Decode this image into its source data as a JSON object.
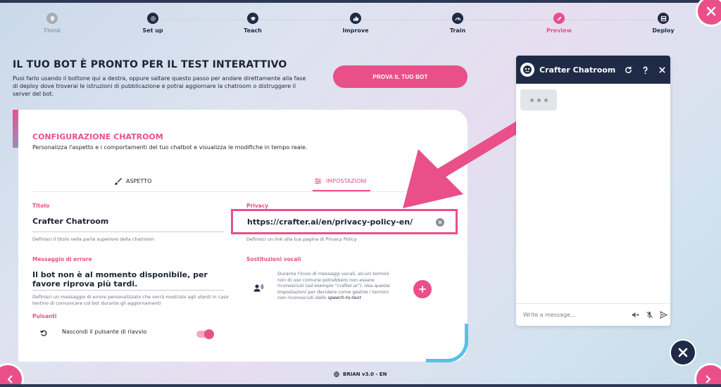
{
  "stepper": {
    "steps": [
      {
        "label": "Think",
        "state": "muted",
        "icon": "location-pin-icon"
      },
      {
        "label": "Set up",
        "state": "done",
        "icon": "gear-icon"
      },
      {
        "label": "Teach",
        "state": "done",
        "icon": "graduation-cap-icon"
      },
      {
        "label": "Improve",
        "state": "done",
        "icon": "thumbs-up-icon"
      },
      {
        "label": "Train",
        "state": "done",
        "icon": "gauge-icon"
      },
      {
        "label": "Preview",
        "state": "active",
        "icon": "pencil-icon"
      },
      {
        "label": "Deploy",
        "state": "done",
        "icon": "server-icon"
      }
    ]
  },
  "hero": {
    "title": "IL TUO BOT È PRONTO PER IL TEST INTERATTIVO",
    "description": "Puoi farlo usando il bottone qui a destra, oppure saltare questo passo per andare direttamente alla fase di deploy dove troverai le istruzioni di pubblicazione e potrai aggiornare la chatroom o distruggere il server del bot.",
    "try_button": "PROVA IL TUO BOT"
  },
  "config": {
    "title": "CONFIGURAZIONE CHATROOM",
    "subtitle": "Personalizza l'aspetto e i comportamenti del tuo chatbot e visualizza le modifiche in tempo reale.",
    "tabs": {
      "aspetto": "ASPETTO",
      "impostazioni": "IMPOSTAZIONI"
    },
    "titolo": {
      "label": "Titolo",
      "value": "Crafter Chatroom",
      "hint": "Definisci il titolo nella parte superiore della chatroom"
    },
    "privacy": {
      "label": "Privacy",
      "value": "https://crafter.ai/en/privacy-policy-en/",
      "hint": "Definisci un link alla tua pagina di Privacy Policy"
    },
    "errore": {
      "label": "Messaggio di errore",
      "value": "Il bot non è al momento disponibile, per favore riprova più tardi.",
      "hint": "Definisci un messaggio di errore personalizzato che verrà mostrato agli utenti in caso tentino di comunicare col bot durante gli aggiornamenti"
    },
    "vocali": {
      "label": "Sostituzioni vocali",
      "text": "Durante l'invio di messaggi vocali, alcuni termini non di uso comune potrebbero non essere riconosciuti (ad esempio \"crafter.ai\"). Usa queste impostazioni per decidere come gestire i termini non riconosciuti dallo",
      "text_em": "speech-to-text"
    },
    "pulsanti": {
      "label": "Pulsanti",
      "reset_label": "Nascondi il pulsante di riavvio"
    }
  },
  "chat": {
    "title": "Crafter Chatroom",
    "input_placeholder": "Write a message..."
  },
  "footer": {
    "version": "BRIAN v3.0 - EN"
  },
  "colors": {
    "accent": "#e9508a",
    "navy": "#1f2b46",
    "cyan": "#56c2e6"
  }
}
